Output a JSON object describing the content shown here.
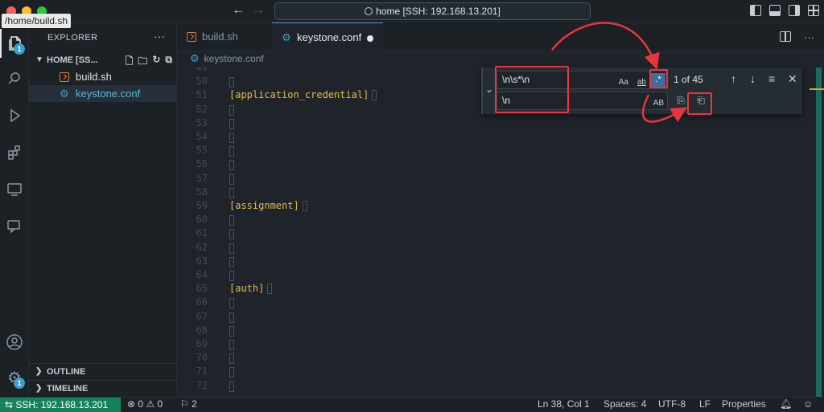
{
  "titlebar": {
    "tooltip": "/home/build.sh",
    "back_icon": "←",
    "forward_icon": "→",
    "command_center": "home [SSH: 192.168.13.201]"
  },
  "activity": {
    "explorer_badge": "1",
    "settings_badge": "1"
  },
  "sidebar": {
    "title": "EXPLORER",
    "more": "···",
    "section": "HOME [SS...",
    "files": [
      {
        "name": "build.sh"
      },
      {
        "name": "keystone.conf"
      }
    ],
    "outline": "OUTLINE",
    "timeline": "TIMELINE"
  },
  "tabs": [
    {
      "label": "build.sh"
    },
    {
      "label": "keystone.conf"
    }
  ],
  "breadcrumb": "keystone.conf",
  "editor": {
    "lines": [
      {
        "n": "49",
        "text": ""
      },
      {
        "n": "50",
        "text": ""
      },
      {
        "n": "51",
        "text": "[application_credential]"
      },
      {
        "n": "52",
        "text": ""
      },
      {
        "n": "53",
        "text": ""
      },
      {
        "n": "54",
        "text": ""
      },
      {
        "n": "55",
        "text": ""
      },
      {
        "n": "56",
        "text": ""
      },
      {
        "n": "57",
        "text": ""
      },
      {
        "n": "58",
        "text": ""
      },
      {
        "n": "59",
        "text": "[assignment]"
      },
      {
        "n": "60",
        "text": ""
      },
      {
        "n": "61",
        "text": ""
      },
      {
        "n": "62",
        "text": ""
      },
      {
        "n": "63",
        "text": ""
      },
      {
        "n": "64",
        "text": ""
      },
      {
        "n": "65",
        "text": "[auth]"
      },
      {
        "n": "66",
        "text": ""
      },
      {
        "n": "67",
        "text": ""
      },
      {
        "n": "68",
        "text": ""
      },
      {
        "n": "69",
        "text": ""
      },
      {
        "n": "70",
        "text": ""
      },
      {
        "n": "71",
        "text": ""
      },
      {
        "n": "72",
        "text": ""
      }
    ]
  },
  "find": {
    "search_value": "\\n\\s*\\n",
    "replace_value": "\\n",
    "match_case": "Aa",
    "whole_word": "ab",
    "regex": ".*",
    "preserve_case": "AB",
    "count": "1 of 45"
  },
  "status": {
    "remote": "SSH: 192.168.13.201",
    "errors": "0",
    "warnings": "0",
    "ports": "2",
    "position": "Ln 38, Col 1",
    "spaces": "Spaces: 4",
    "encoding": "UTF-8",
    "eol": "LF",
    "language": "Properties"
  },
  "colors": {
    "accent": "#3aa0d0",
    "remote_bg": "#16825d",
    "annotation": "#e8353d",
    "section_text": "#e8b84a"
  }
}
